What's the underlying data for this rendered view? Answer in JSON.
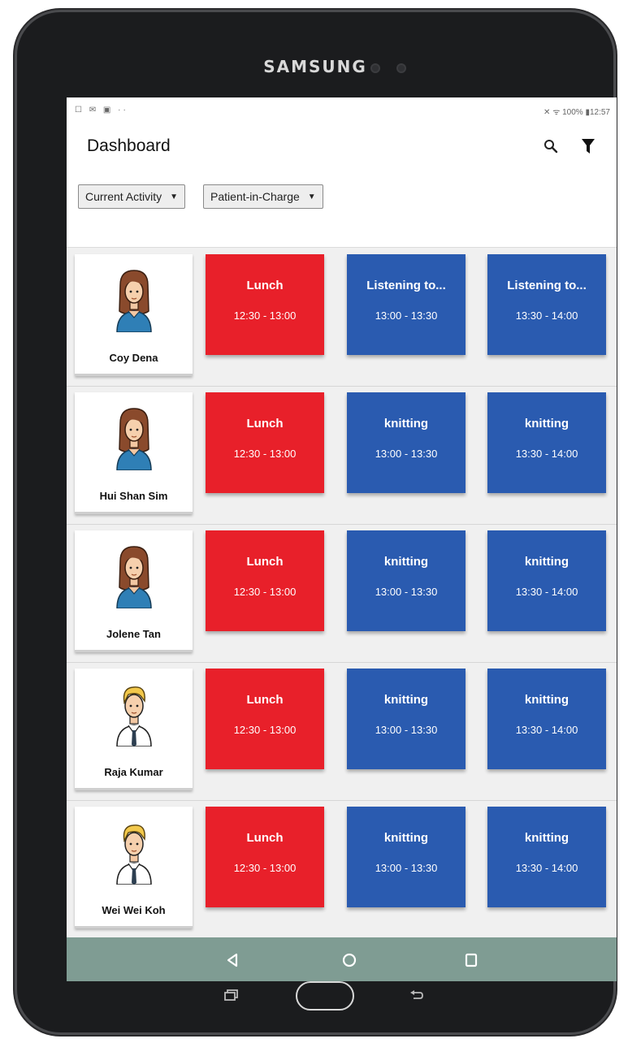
{
  "device": {
    "brand": "SAMSUNG"
  },
  "statusbar": {
    "left_icons": "☐ ✉ ▣ ··",
    "right_text": "✕ ᯤ 100% ▮12:57"
  },
  "appbar": {
    "title": "Dashboard",
    "search_icon": "search-icon",
    "filter_icon": "filter-icon"
  },
  "filters": [
    {
      "label": "Current Activity"
    },
    {
      "label": "Patient-in-Charge"
    }
  ],
  "colors": {
    "lunch": "#e8202a",
    "activity": "#2a5bb0",
    "navbar": "#7f9c93"
  },
  "patients": [
    {
      "name": "Coy Dena",
      "avatar": "female-avatar",
      "activities": [
        {
          "name": "Lunch",
          "time": "12:30 - 13:00",
          "color": "red"
        },
        {
          "name": "Listening to...",
          "time": "13:00 - 13:30",
          "color": "blue"
        },
        {
          "name": "Listening to...",
          "time": "13:30 - 14:00",
          "color": "blue"
        }
      ]
    },
    {
      "name": "Hui Shan Sim",
      "avatar": "female-avatar",
      "activities": [
        {
          "name": "Lunch",
          "time": "12:30 - 13:00",
          "color": "red"
        },
        {
          "name": "knitting",
          "time": "13:00 - 13:30",
          "color": "blue"
        },
        {
          "name": "knitting",
          "time": "13:30 - 14:00",
          "color": "blue"
        }
      ]
    },
    {
      "name": "Jolene Tan",
      "avatar": "female-avatar",
      "activities": [
        {
          "name": "Lunch",
          "time": "12:30 - 13:00",
          "color": "red"
        },
        {
          "name": "knitting",
          "time": "13:00 - 13:30",
          "color": "blue"
        },
        {
          "name": "knitting",
          "time": "13:30 - 14:00",
          "color": "blue"
        }
      ]
    },
    {
      "name": "Raja Kumar",
      "avatar": "male-avatar",
      "activities": [
        {
          "name": "Lunch",
          "time": "12:30 - 13:00",
          "color": "red"
        },
        {
          "name": "knitting",
          "time": "13:00 - 13:30",
          "color": "blue"
        },
        {
          "name": "knitting",
          "time": "13:30 - 14:00",
          "color": "blue"
        }
      ]
    },
    {
      "name": "Wei Wei Koh",
      "avatar": "male-avatar",
      "activities": [
        {
          "name": "Lunch",
          "time": "12:30 - 13:00",
          "color": "red"
        },
        {
          "name": "knitting",
          "time": "13:00 - 13:30",
          "color": "blue"
        },
        {
          "name": "knitting",
          "time": "13:30 - 14:00",
          "color": "blue"
        }
      ]
    }
  ],
  "navbar": {
    "back_icon": "back-triangle-icon",
    "home_icon": "home-circle-icon",
    "recents_icon": "recents-square-icon"
  }
}
